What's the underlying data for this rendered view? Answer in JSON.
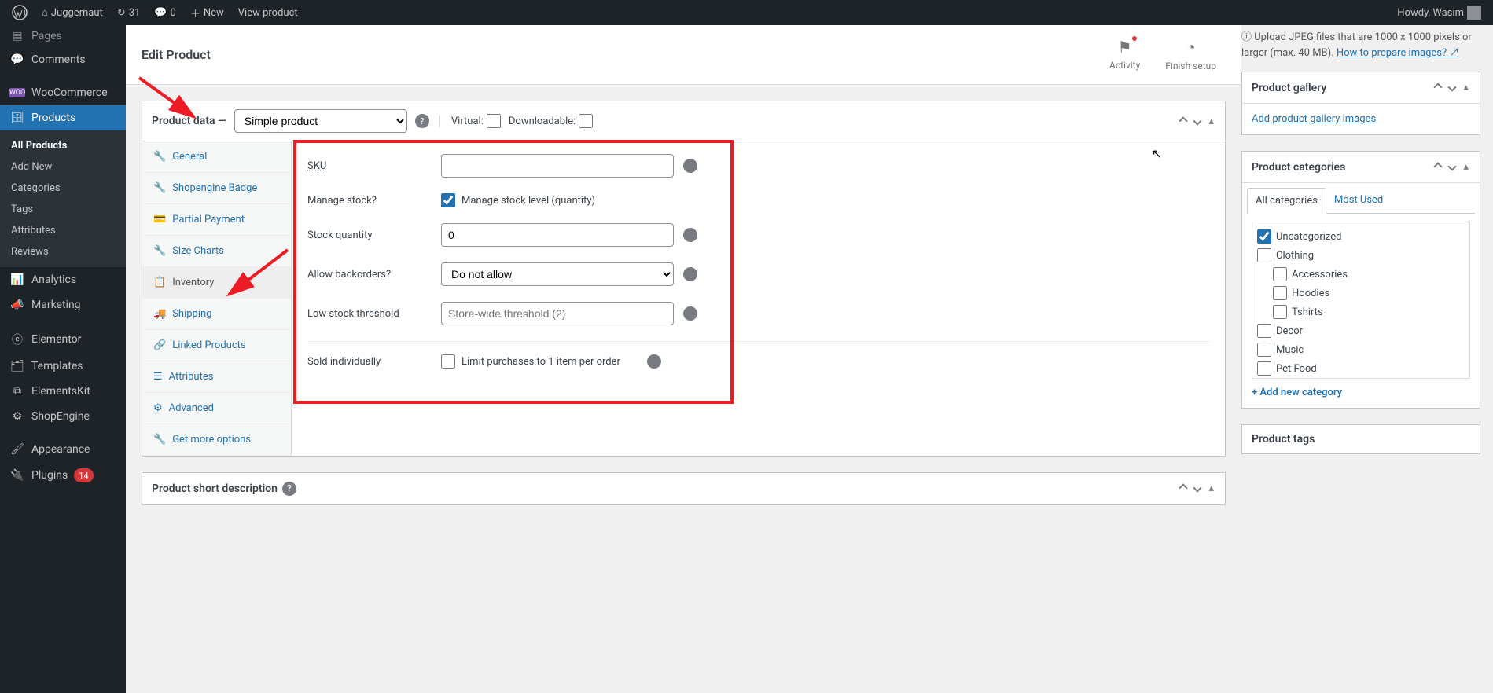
{
  "topbar": {
    "site_name": "Juggernaut",
    "updates_count": "31",
    "comments_count": "0",
    "new_label": "New",
    "view_product": "View product",
    "howdy": "Howdy, Wasim"
  },
  "sidebar": {
    "pages": "Pages",
    "comments": "Comments",
    "woocommerce": "WooCommerce",
    "products": "Products",
    "sub": {
      "all": "All Products",
      "add": "Add New",
      "categories": "Categories",
      "tags": "Tags",
      "attributes": "Attributes",
      "reviews": "Reviews"
    },
    "analytics": "Analytics",
    "marketing": "Marketing",
    "elementor": "Elementor",
    "templates": "Templates",
    "elementskit": "ElementsKit",
    "shopengine": "ShopEngine",
    "appearance": "Appearance",
    "plugins": "Plugins",
    "plugins_count": "14"
  },
  "page": {
    "title": "Edit Product",
    "activity": "Activity",
    "finish": "Finish setup"
  },
  "product_data": {
    "heading": "Product data —",
    "type": "Simple product",
    "virtual": "Virtual:",
    "downloadable": "Downloadable:",
    "tabs": {
      "general": "General",
      "badge": "Shopengine Badge",
      "partial": "Partial Payment",
      "size": "Size Charts",
      "inventory": "Inventory",
      "shipping": "Shipping",
      "linked": "Linked Products",
      "attributes": "Attributes",
      "advanced": "Advanced",
      "more": "Get more options"
    },
    "fields": {
      "sku": "SKU",
      "sku_val": "",
      "manage": "Manage stock?",
      "manage_label": "Manage stock level (quantity)",
      "qty": "Stock quantity",
      "qty_val": "0",
      "backorders": "Allow backorders?",
      "backorders_val": "Do not allow",
      "low": "Low stock threshold",
      "low_ph": "Store-wide threshold (2)",
      "sold": "Sold individually",
      "sold_label": "Limit purchases to 1 item per order"
    }
  },
  "short_desc_heading": "Product short description",
  "gallery": {
    "heading": "Product gallery",
    "add": "Add product gallery images",
    "tip1": "Upload JPEG files that are 1000 x 1000 pixels or larger (max. 40 MB). ",
    "tip2": "How to prepare images?"
  },
  "categories": {
    "heading": "Product categories",
    "tab_all": "All categories",
    "tab_most": "Most Used",
    "items": [
      "Uncategorized",
      "Clothing",
      "Accessories",
      "Hoodies",
      "Tshirts",
      "Decor",
      "Music",
      "Pet Food"
    ],
    "add_new": "+ Add new category"
  },
  "tags_heading": "Product tags"
}
